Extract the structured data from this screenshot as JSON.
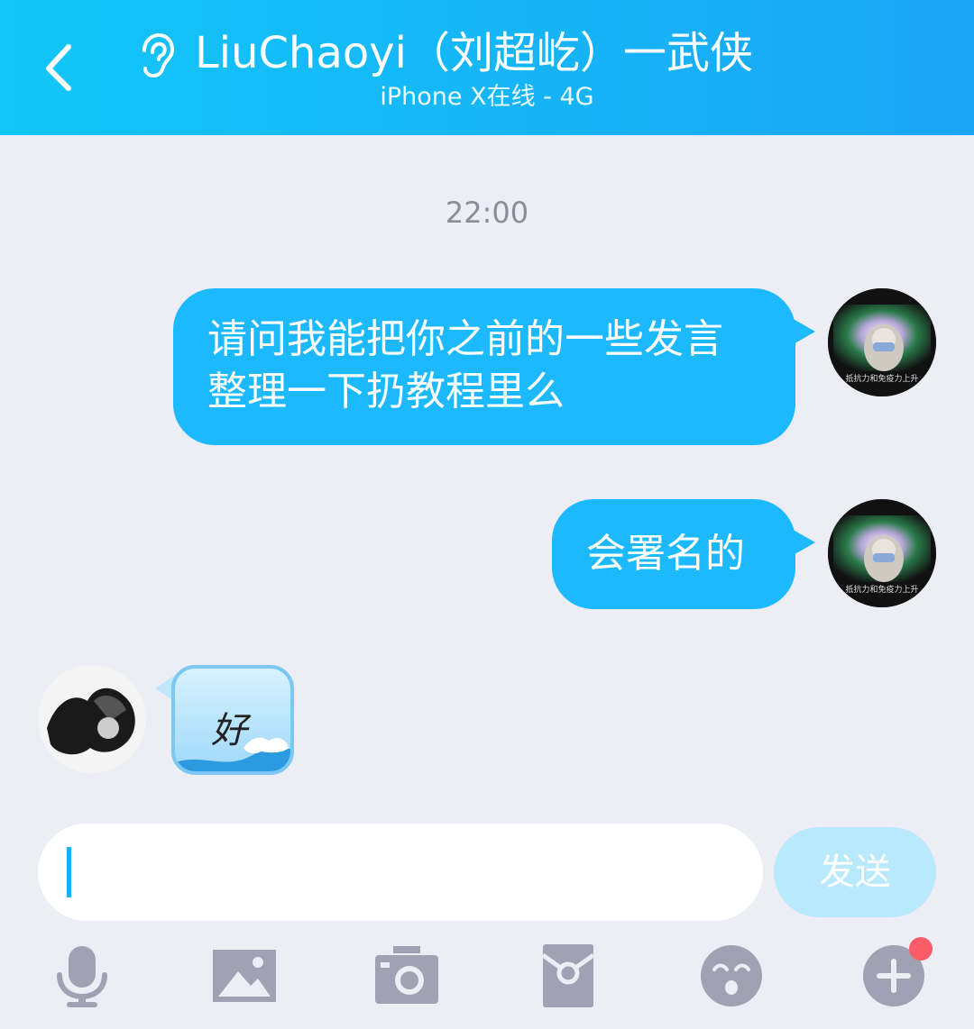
{
  "header": {
    "title": "LiuChaoyi（刘超屹）一武侠",
    "subtitle": "iPhone X在线 - 4G"
  },
  "chat": {
    "timestamp": "22:00",
    "messages": [
      {
        "from": "me",
        "text": "请问我能把你之前的一些发言整理一下扔教程里么"
      },
      {
        "from": "me",
        "text": "会署名的"
      },
      {
        "from": "other",
        "sticker_text": "好"
      }
    ],
    "my_avatar_caption": "抵抗力和免疫力上升"
  },
  "input": {
    "value": "",
    "send_label": "发送"
  },
  "toolbar": {
    "icons": [
      "microphone-icon",
      "image-icon",
      "camera-icon",
      "red-packet-icon",
      "emoji-icon",
      "plus-icon"
    ]
  },
  "colors": {
    "header_gradient_start": "#12c6f8",
    "header_gradient_end": "#1aa6f6",
    "bubble": "#1db9ff",
    "background": "#ecedf5",
    "send_button": "#b8e9fc",
    "toolbar_icon": "#a0a1b3",
    "badge": "#fb5d68"
  }
}
